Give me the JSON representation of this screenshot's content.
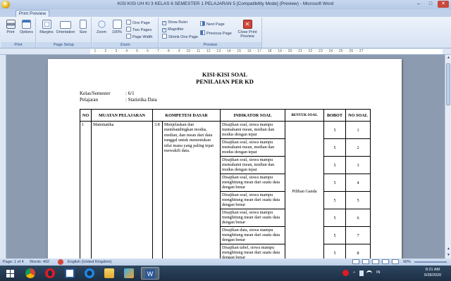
{
  "window": {
    "title": "KISI KISI UH KI 3 KELAS 6 SEMESTER 1 PELAJARAN 5 [Compatibility Mode] (Preview) - Microsoft Word",
    "minimize": "–",
    "maximize": "□",
    "close": "✕"
  },
  "tab": {
    "label": "Print Preview"
  },
  "ribbon": {
    "print_group": {
      "label": "Print",
      "print": "Print",
      "options": "Options"
    },
    "page_setup_group": {
      "label": "Page Setup",
      "margins": "Margins",
      "orientation": "Orientation",
      "size": "Size"
    },
    "zoom_group": {
      "label": "Zoom",
      "zoom": "Zoom",
      "zoom100": "100%",
      "one_page": "One Page",
      "two_pages": "Two Pages",
      "page_width": "Page Width"
    },
    "preview_group": {
      "label": "Preview",
      "show_ruler": "Show Ruler",
      "magnifier": "Magnifier",
      "shrink_one_page": "Shrink One Page",
      "next_page": "Next Page",
      "previous_page": "Previous Page",
      "close_preview_line1": "Close Print",
      "close_preview_line2": "Preview",
      "check_mark": "✓"
    }
  },
  "ruler": {
    "ticks": "· 1 · · · 2 · · · 3 · · · 4 · · · 5 · · · 6 · · · 7 · · · 8 · · · 9 · · 10 · · 11 · · 12 · · 13 · · 14 · · 15 · · 16 · · 17 · · 18 · · 19 · · 20 · · 21 · · 22 · · 23 · · 24 · · 25 · · 26 · · 27"
  },
  "document": {
    "title1": "KISI-KISI SOAL",
    "title2": "PENILAIAN PER KD",
    "kelas_label": "Kelas/Semester",
    "kelas_value": ": 6/1",
    "pelajaran_label": "Pelajaran",
    "pelajaran_value": ": Statistika Data",
    "headers": {
      "no": "NO",
      "muatan": "MUATAN PELAJARAN",
      "kd": "KOMPETESI DASAR",
      "indikator": "INDIKATOR SOAL",
      "bentuk": "BENTUK SOAL",
      "bobot": "BOBOT",
      "no_soal": "NO SOAL"
    },
    "row_no": "1",
    "muatan": "Matematika",
    "kd_code": "3.8",
    "kd_text": "Menjelaskan dan membandingkan modus, median, dan mean dari data tunggal untuk menentukan nilai mana yang paling tepat mewakili data.",
    "bentuk": "Pilihan Ganda",
    "rows": [
      {
        "indikator": "Disajikan soal, siswa mampu memahami mean, median dan modus dengan tepat",
        "bobot": "5",
        "no_soal": "1"
      },
      {
        "indikator": "Disajikan soal, siswa mampu memahami mean, median dan modus dengan tepat",
        "bobot": "5",
        "no_soal": "2"
      },
      {
        "indikator": "Disajikan soal, siswa mampu memahami mean, median dan modus dengan tepat",
        "bobot": "5",
        "no_soal": "3"
      },
      {
        "indikator": "Disajikan soal, siswa mampu menghitung mean dari suatu data dengan benar",
        "bobot": "5",
        "no_soal": "4"
      },
      {
        "indikator": "Disajikan soal, siswa mampu menghitung mean dari suatu data dengan benar",
        "bobot": "5",
        "no_soal": "5"
      },
      {
        "indikator": "Disajikan soal, siswa mampu menghitung mean dari suatu data dengan benar",
        "bobot": "5",
        "no_soal": "6"
      },
      {
        "indikator": "Disajikan data, siswa mampu menghitung mean dari suatu data dengan benar",
        "bobot": "5",
        "no_soal": "7"
      },
      {
        "indikator": "Disajikan tabel, siswa mampu menghitung mean dari suatu data dengan benar",
        "bobot": "5",
        "no_soal": "8"
      }
    ]
  },
  "statusbar": {
    "page": "Page: 1 of 4",
    "words": "Words: 492",
    "language": "English (United Kingdom)",
    "zoom": "90%"
  },
  "taskbar": {
    "language": "IN",
    "time": "8:21 AM",
    "date": "9/28/2020"
  },
  "colors": {
    "accent": "#2b4c7e",
    "taskbar": "#1c2f44",
    "close_button": "#c9463d"
  },
  "icons": [
    "print-icon",
    "options-icon",
    "margins-icon",
    "orientation-icon",
    "size-icon",
    "zoom-icon",
    "zoom100-icon",
    "one-page-icon",
    "two-pages-icon",
    "page-width-icon",
    "next-page-icon",
    "previous-page-icon",
    "close-preview-icon",
    "start-icon",
    "chrome-icon",
    "opera-icon",
    "ie-icon",
    "explorer-icon",
    "app-icon",
    "word-icon"
  ]
}
